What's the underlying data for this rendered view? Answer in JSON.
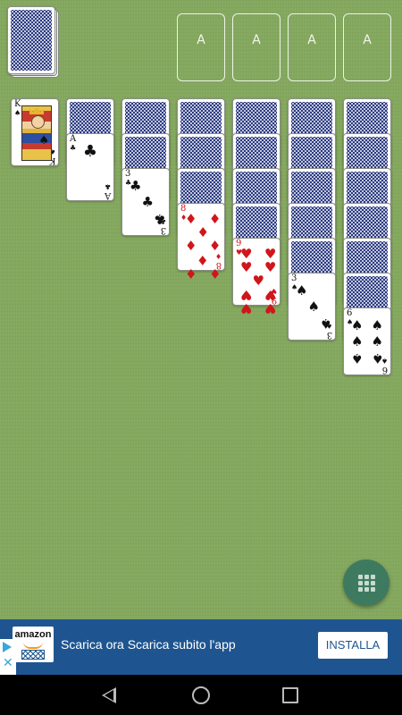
{
  "foundations": [
    {
      "label": "A"
    },
    {
      "label": "A"
    },
    {
      "label": "A"
    },
    {
      "label": "A"
    }
  ],
  "tableau": [
    {
      "hidden": 0,
      "face": {
        "rank": "K",
        "suit": "♠",
        "color": "black",
        "court": true
      }
    },
    {
      "hidden": 1,
      "face": {
        "rank": "A",
        "suit": "♣",
        "color": "black"
      }
    },
    {
      "hidden": 2,
      "face": {
        "rank": "3",
        "suit": "♣",
        "color": "black"
      }
    },
    {
      "hidden": 3,
      "face": {
        "rank": "8",
        "suit": "♦",
        "color": "red"
      }
    },
    {
      "hidden": 4,
      "face": {
        "rank": "9",
        "suit": "♥",
        "color": "red"
      }
    },
    {
      "hidden": 5,
      "face": {
        "rank": "3",
        "suit": "♠",
        "color": "black"
      }
    },
    {
      "hidden": 6,
      "face": {
        "rank": "6",
        "suit": "♠",
        "color": "black"
      }
    }
  ],
  "ad": {
    "brand": "amazon",
    "text": "Scarica ora Scarica subito l'app",
    "button": "INSTALLA"
  },
  "colors": {
    "felt": "#84a85e",
    "card_back": "#2c3a7e",
    "red": "#d0151b",
    "ad_bg": "#1e5590",
    "fab": "#3e7a60"
  },
  "icons": {
    "stock": "card-back-stack",
    "menu": "grid-menu-icon",
    "ad_badge": "adchoices-icon",
    "nav": [
      "back-icon",
      "home-icon",
      "recents-icon"
    ]
  }
}
